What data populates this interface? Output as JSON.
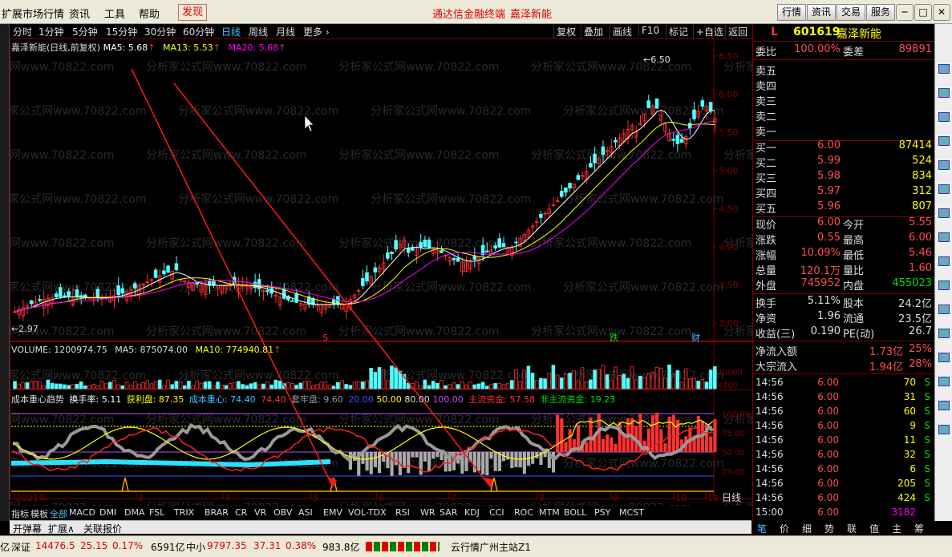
{
  "menu": {
    "items": [
      "扩展市场行情",
      "资讯",
      "工具",
      "帮助",
      "发现"
    ],
    "center": "通达信金融终端",
    "center2": "嘉泽新能",
    "right_buttons": [
      "行情",
      "资讯",
      "交易",
      "服务"
    ]
  },
  "toolbar": {
    "periods": [
      "分时",
      "1分钟",
      "5分钟",
      "15分钟",
      "30分钟",
      "60分钟",
      "日线",
      "周线",
      "月线",
      "更多 ›"
    ],
    "active": "日线",
    "right": [
      "复权",
      "叠加",
      "画线",
      "F10",
      "标记",
      "+自选",
      "返回"
    ]
  },
  "main_chart": {
    "title": "嘉泽新能(日线,前复权)",
    "ma5": "MA5: 5.68",
    "ma13": "MA13: 5.53",
    "ma20": "MA20: 5.68",
    "price_labels": [
      "6.50",
      "6.00",
      "5.50",
      "5.00",
      "4.50",
      "4.00",
      "3.50",
      "3.00"
    ],
    "high_label": "6.50",
    "low_label": "2.97",
    "markers": [
      "S",
      "跌",
      "财"
    ]
  },
  "volume_chart": {
    "volume": "VOLUME: 1200974.75",
    "ma5": "MA5: 875074.00",
    "ma10": "MA10: 774940.81",
    "axis": [
      "20000",
      "X100"
    ]
  },
  "indicator": {
    "name": "成本重心趋势",
    "turnover": "换手率: 5.11",
    "profit": "获利盘: 87.35",
    "cost_center": "成本重心: 74.40",
    "v74": "74.40",
    "trap": "套牢盘: 9.60",
    "ref": "20.00",
    "r50": "50.00",
    "r80": "80.00",
    "r100": "100.00",
    "main_fund": "主流资金: 57.58",
    "nonmain_fund": "非主流资金: 19.23",
    "axis": [
      "100.00",
      "75.00",
      "50.00",
      "25.00"
    ],
    "dates": [
      "2021年",
      "3",
      "4",
      "5",
      "6",
      "7",
      "8",
      "9",
      "10",
      "11"
    ],
    "period_label": "日线"
  },
  "indicator_tabs": [
    "指标",
    "模板",
    "全部",
    "MACD",
    "DMI",
    "DMA",
    "FSL",
    "TRIX",
    "BRAR",
    "CR",
    "VR",
    "OBV",
    "ASI",
    "EMV",
    "VOL-TDX",
    "RSI",
    "WR",
    "SAR",
    "KDJ",
    "CCI",
    "ROC",
    "MTM",
    "BOLL",
    "PSY",
    "MCST"
  ],
  "indicator_tab_active": "全部",
  "bottom_tabs": [
    "开弹幕",
    "扩展∧",
    "关联报价"
  ],
  "panel": {
    "code": "601619",
    "name": "嘉泽新能",
    "ratio_label": "委比",
    "ratio": "100.00%",
    "diff_label": "委差",
    "diff": "89891",
    "sells": [
      {
        "l": "卖五"
      },
      {
        "l": "卖四"
      },
      {
        "l": "卖三"
      },
      {
        "l": "卖二"
      },
      {
        "l": "卖一"
      }
    ],
    "buys": [
      {
        "l": "买一",
        "p": "6.00",
        "v": "87414"
      },
      {
        "l": "买二",
        "p": "5.99",
        "v": "524"
      },
      {
        "l": "买三",
        "p": "5.98",
        "v": "834"
      },
      {
        "l": "买四",
        "p": "5.97",
        "v": "312"
      },
      {
        "l": "买五",
        "p": "5.96",
        "v": "807"
      }
    ],
    "quote": [
      {
        "a": "现价",
        "av": "6.00",
        "b": "今开",
        "bv": "5.55"
      },
      {
        "a": "涨跌",
        "av": "0.55",
        "b": "最高",
        "bv": "6.00"
      },
      {
        "a": "涨幅",
        "av": "10.09%",
        "b": "最低",
        "bv": "5.46"
      },
      {
        "a": "总量",
        "av": "120.1万",
        "b": "量比",
        "bv": "1.60"
      },
      {
        "a": "外盘",
        "av": "745952",
        "b": "内盘",
        "bv": "455023"
      }
    ],
    "stats": [
      {
        "a": "换手",
        "av": "5.11%",
        "b": "股本",
        "bv": "24.2亿"
      },
      {
        "a": "净资",
        "av": "1.96",
        "b": "流通",
        "bv": "23.5亿"
      },
      {
        "a": "收益(三)",
        "av": "0.190",
        "b": "PE(动)",
        "bv": "26.7"
      }
    ],
    "flow": [
      {
        "a": "净流入额",
        "av": "1.73亿",
        "p": "25%"
      },
      {
        "a": "大宗流入",
        "av": "1.94亿",
        "p": "28%"
      }
    ],
    "ticks": [
      {
        "t": "14:56",
        "p": "6.00",
        "v": "70",
        "s": "S"
      },
      {
        "t": "14:56",
        "p": "6.00",
        "v": "31",
        "s": "S"
      },
      {
        "t": "14:56",
        "p": "6.00",
        "v": "60",
        "s": "S"
      },
      {
        "t": "14:56",
        "p": "6.00",
        "v": "9",
        "s": "S"
      },
      {
        "t": "14:56",
        "p": "6.00",
        "v": "11",
        "s": "S"
      },
      {
        "t": "14:56",
        "p": "6.00",
        "v": "32",
        "s": "S"
      },
      {
        "t": "14:56",
        "p": "6.00",
        "v": "6",
        "s": "S"
      },
      {
        "t": "14:56",
        "p": "6.00",
        "v": "205",
        "s": "S"
      },
      {
        "t": "14:56",
        "p": "6.00",
        "v": "424",
        "s": "S"
      },
      {
        "t": "15:00",
        "p": "6.00",
        "v": "3182",
        "s": ""
      }
    ],
    "btm": [
      "笔",
      "价",
      "细",
      "势",
      "联",
      "值",
      "主",
      "筹"
    ]
  },
  "status": {
    "prefix": "亿",
    "sz_label": "深证",
    "sz_val": "14476.5",
    "sz_chg": "25.15",
    "sz_pct": "0.17%",
    "sz_amt": "6591亿",
    "mid_label": "中小",
    "mid_val": "9797.35",
    "mid_chg": "37.31",
    "mid_pct": "0.38%",
    "mid_amt": "983.8亿",
    "server": "云行情广州主站Z1"
  },
  "watermark": "分析家公式网www.70822.com",
  "colors": {
    "up": "#ff3232",
    "down": "#54ffff",
    "ma5": "#ffffff",
    "ma13": "#ffff00",
    "ma20": "#ff00ff",
    "accent": "#3cc8ff"
  }
}
